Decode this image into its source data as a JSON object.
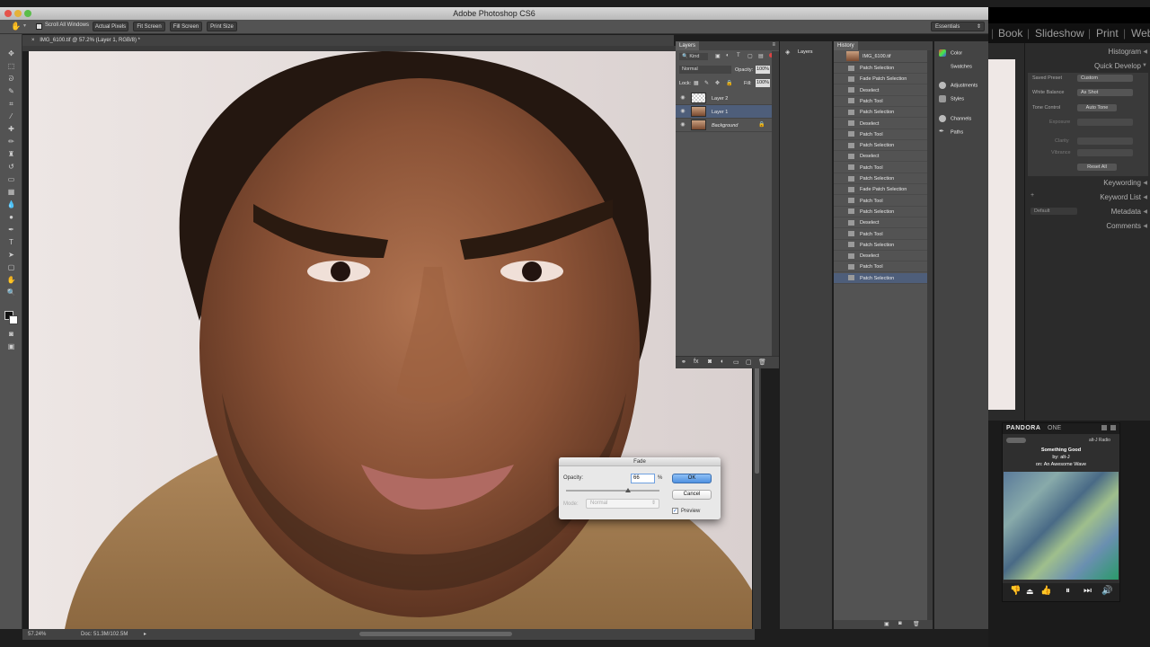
{
  "window": {
    "title": "Adobe Photoshop CS6",
    "workspace": "Essentials",
    "doc_tab": "IMG_6100.tif @ 57.2% (Layer 1, RGB/8) *"
  },
  "options_bar": {
    "scroll_all": "Scroll All Windows",
    "actual_pixels": "Actual Pixels",
    "fit_screen": "Fit Screen",
    "fill_screen": "Fill Screen",
    "print_size": "Print Size"
  },
  "status": {
    "zoom": "57.24%",
    "doc_size": "Doc: 51.3M/102.5M"
  },
  "layers_panel": {
    "tab": "Layers",
    "kind": "Kind",
    "blend_mode": "Normal",
    "opacity_label": "Opacity:",
    "opacity_value": "100%",
    "lock_label": "Lock:",
    "fill_label": "Fill:",
    "fill_value": "100%",
    "layers": [
      {
        "name": "Layer 2"
      },
      {
        "name": "Layer 1"
      },
      {
        "name": "Background"
      }
    ]
  },
  "mini_panel": {
    "layers_label": "Layers"
  },
  "history_panel": {
    "tab": "History",
    "snapshot": "IMG_6100.tif",
    "steps": [
      "Patch Selection",
      "Fade Patch Selection",
      "Deselect",
      "Patch Tool",
      "Patch Selection",
      "Deselect",
      "Patch Tool",
      "Patch Selection",
      "Deselect",
      "Patch Tool",
      "Patch Selection",
      "Fade Patch Selection",
      "Patch Tool",
      "Patch Selection",
      "Deselect",
      "Patch Tool",
      "Patch Selection",
      "Deselect",
      "Patch Tool",
      "Patch Selection"
    ]
  },
  "side_panels": {
    "color": "Color",
    "swatches": "Swatches",
    "adjustments": "Adjustments",
    "styles": "Styles",
    "channels": "Channels",
    "paths": "Paths"
  },
  "fade_dialog": {
    "title": "Fade",
    "opacity_label": "Opacity:",
    "opacity_value": "66",
    "percent": "%",
    "ok": "OK",
    "cancel": "Cancel",
    "mode_label": "Mode:",
    "mode_value": "Normal",
    "preview": "Preview",
    "slider_value": 66
  },
  "lightroom": {
    "modules": [
      "Book",
      "Slideshow",
      "Print",
      "Web"
    ],
    "histogram": "Histogram",
    "quick_develop": "Quick Develop",
    "saved_preset_label": "Saved Preset",
    "saved_preset_value": "Custom",
    "white_balance_label": "White Balance",
    "white_balance_value": "As Shot",
    "tone_control_label": "Tone Control",
    "auto_tone": "Auto Tone",
    "exposure": "Exposure",
    "clarity": "Clarity",
    "vibrance": "Vibrance",
    "reset_all": "Reset All",
    "keywording": "Keywording",
    "keyword_list": "Keyword List",
    "metadata_preset": "Default",
    "metadata": "Metadata",
    "comments": "Comments"
  },
  "pandora": {
    "logo_left": "PANDORA",
    "logo_right": "ONE",
    "station": "alt-J Radio",
    "song": "Something Good",
    "artist": "by: alt-J",
    "album": "on: An Awesome Wave"
  }
}
